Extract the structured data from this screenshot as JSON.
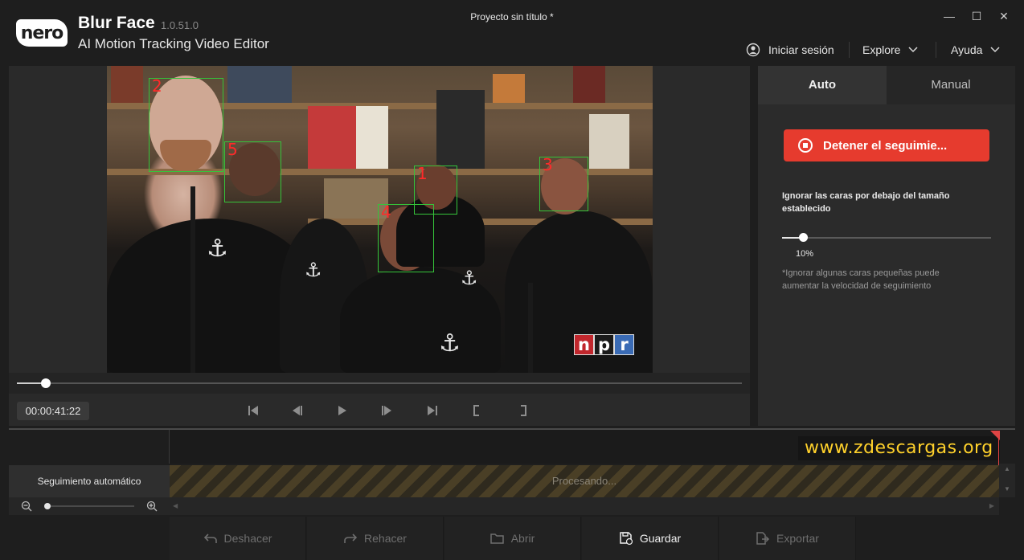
{
  "app": {
    "brand": "nero",
    "name": "Blur Face",
    "version": "1.0.51.0",
    "subtitle": "AI Motion Tracking Video Editor",
    "project_title": "Proyecto sin título *"
  },
  "window_controls": {
    "minimize": "—",
    "maximize": "☐",
    "close": "✕"
  },
  "header_nav": {
    "login": "Iniciar sesión",
    "explore": "Explore",
    "help": "Ayuda"
  },
  "video": {
    "track_labels": [
      "1",
      "2",
      "3",
      "4",
      "5"
    ],
    "logo_letters": [
      "n",
      "p",
      "r"
    ]
  },
  "player": {
    "timecode": "00:00:41:22",
    "progress": 0.04
  },
  "panel": {
    "tabs": [
      {
        "label": "Auto",
        "active": true
      },
      {
        "label": "Manual",
        "active": false
      }
    ],
    "stop_button": "Detener el seguimie...",
    "size_label": "Ignorar las caras por debajo del tamaño establecido",
    "slider_value": "10%",
    "slider_fraction": 0.1,
    "hint": "*Ignorar algunas caras pequeñas puede aumentar la velocidad de seguimiento"
  },
  "timeline": {
    "watermark": "www.zdescargas.org",
    "track_name": "Seguimiento automático",
    "processing": "Procesando..."
  },
  "toolbar": {
    "undo": "Deshacer",
    "redo": "Rehacer",
    "open": "Abrir",
    "save": "Guardar",
    "export": "Exportar"
  },
  "colors": {
    "accent_red": "#e63b2e",
    "track_box_green": "#35c43a",
    "track_number_red": "#ff2a2a",
    "watermark_yellow": "#ffd12b"
  }
}
